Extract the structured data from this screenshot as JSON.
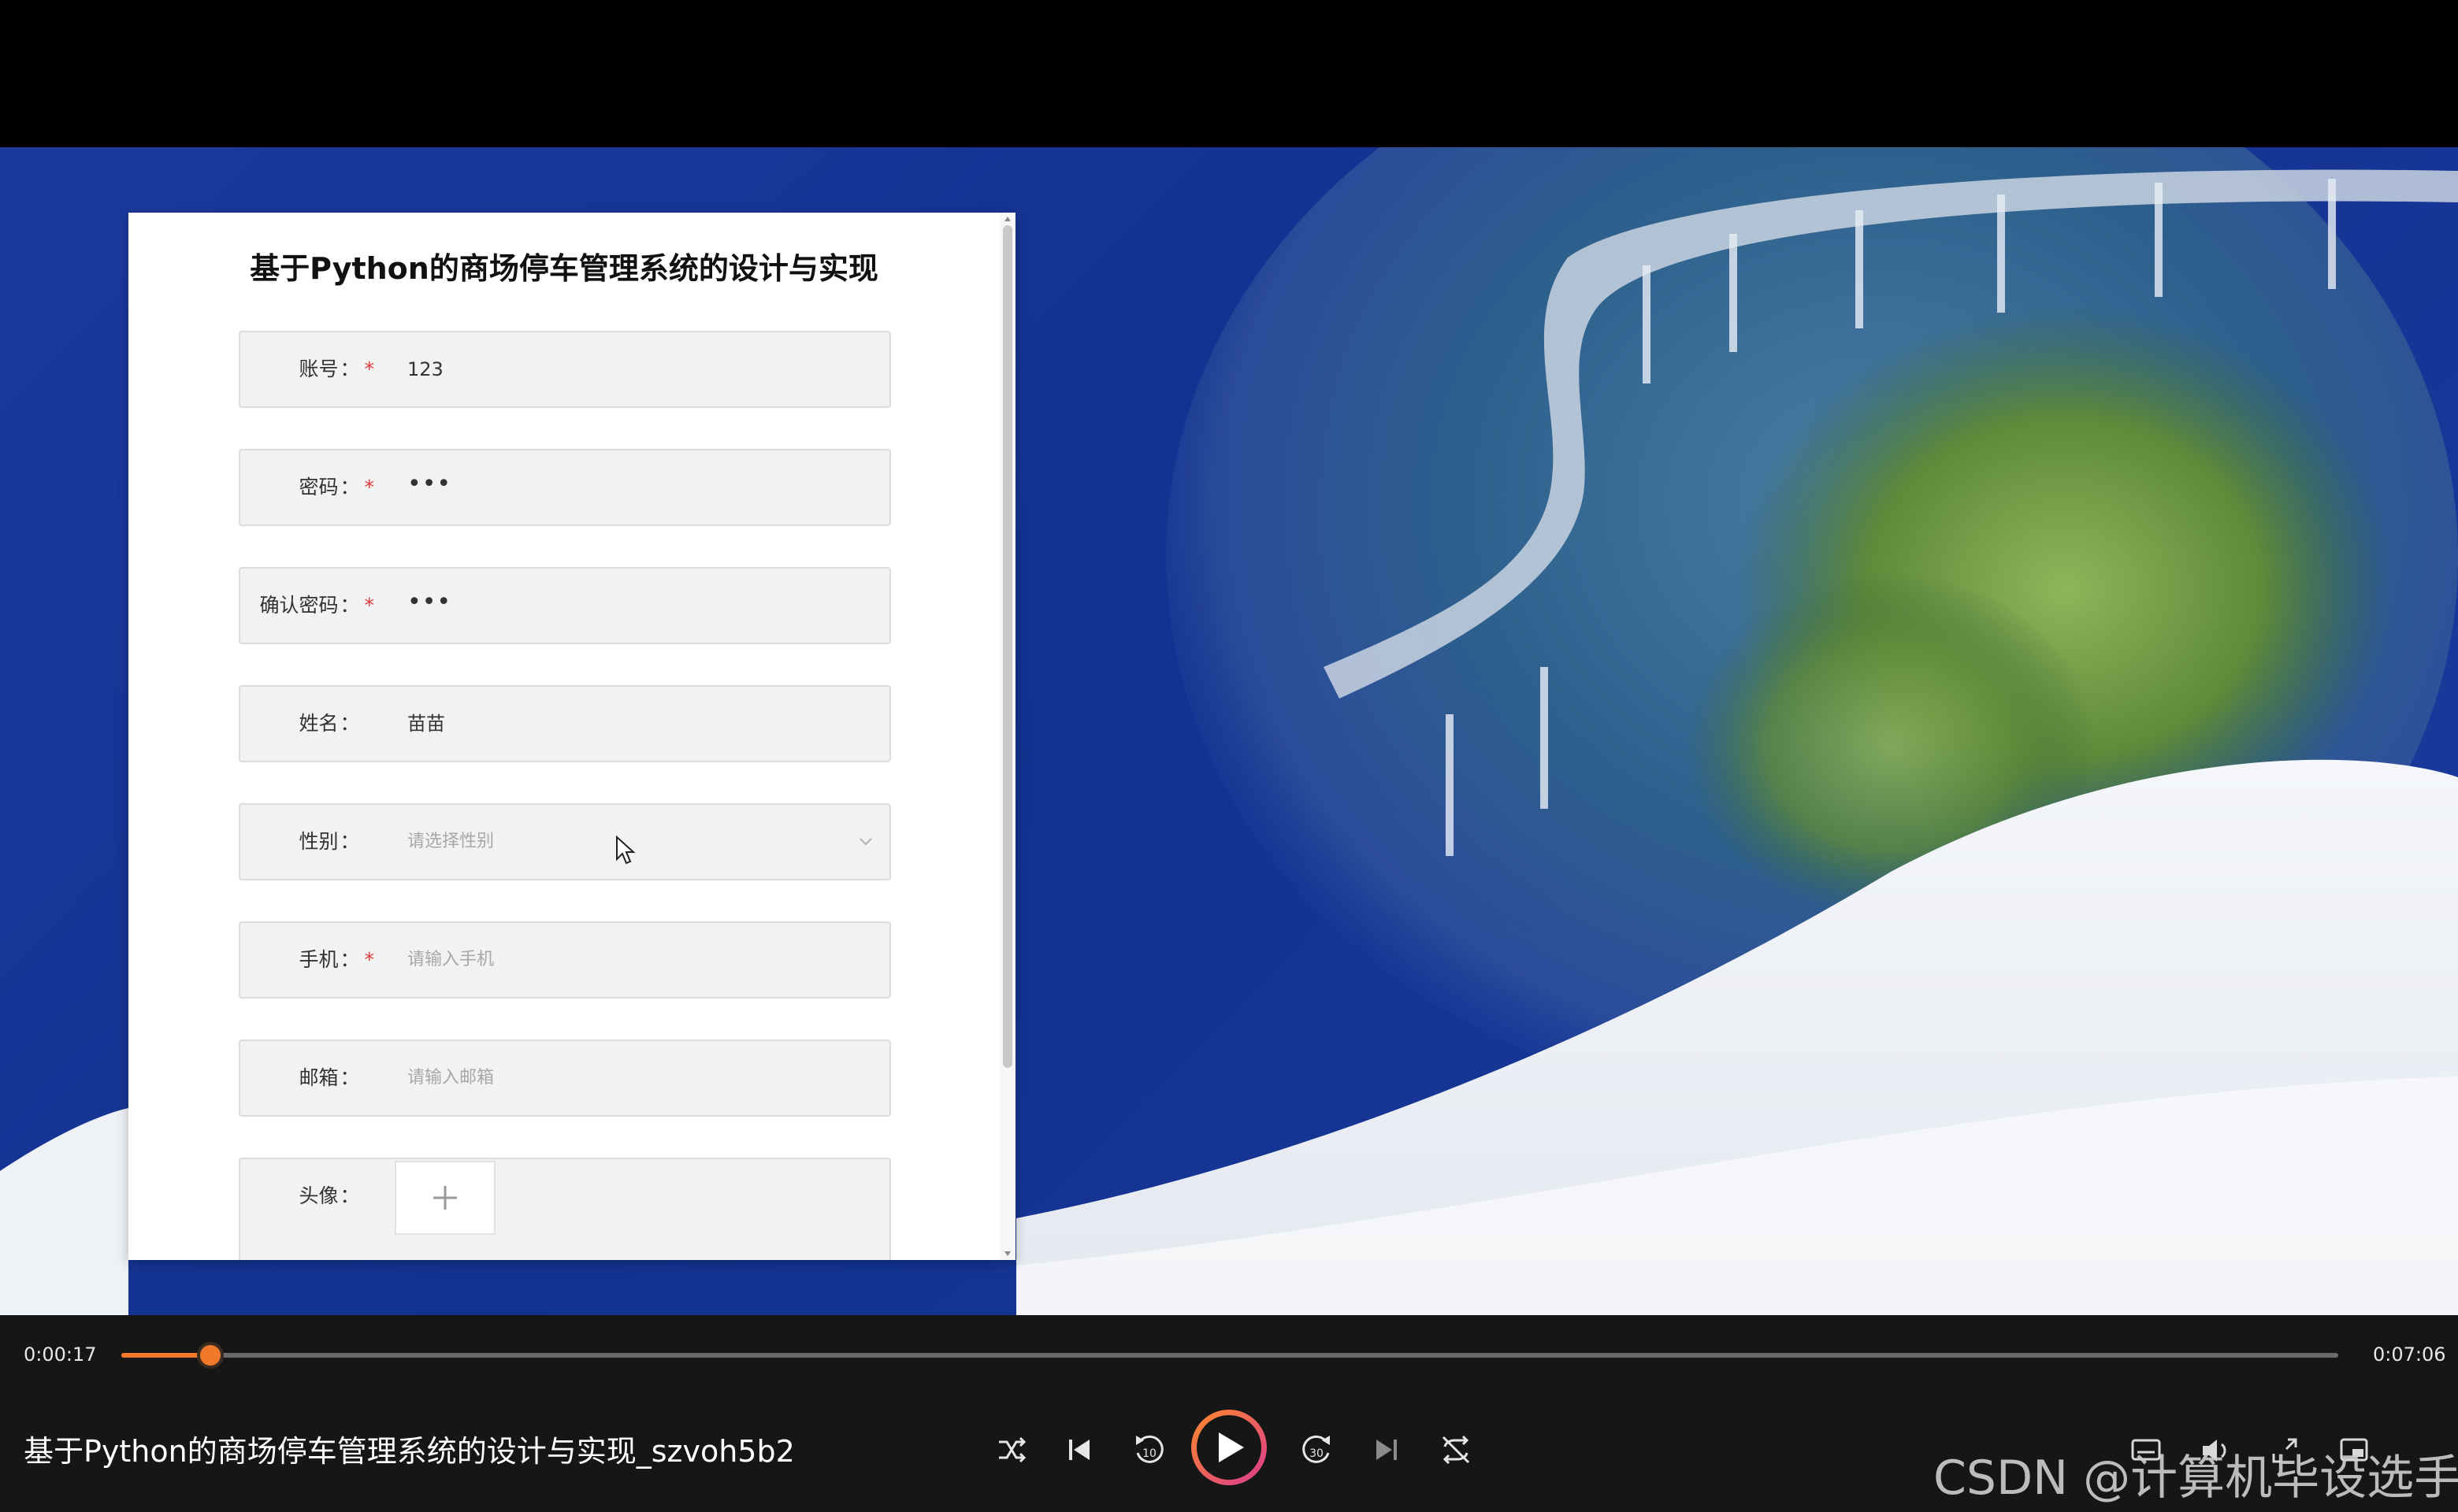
{
  "form": {
    "title": "基于Python的商场停车管理系统的设计与实现",
    "fields": [
      {
        "label": "账号",
        "required": true,
        "value": "123",
        "placeholder": ""
      },
      {
        "label": "密码",
        "required": true,
        "value": "•••",
        "placeholder": ""
      },
      {
        "label": "确认密码",
        "required": true,
        "value": "•••",
        "placeholder": ""
      },
      {
        "label": "姓名",
        "required": false,
        "value": "苗苗",
        "placeholder": ""
      },
      {
        "label": "性别",
        "required": false,
        "value": "",
        "placeholder": "请选择性别"
      },
      {
        "label": "手机",
        "required": true,
        "value": "",
        "placeholder": "请输入手机"
      },
      {
        "label": "邮箱",
        "required": false,
        "value": "",
        "placeholder": "请输入邮箱"
      },
      {
        "label": "头像",
        "required": false,
        "value": "",
        "placeholder": ""
      }
    ],
    "required_mark": "*",
    "colon": "："
  },
  "player": {
    "time_current": "0:00:17",
    "time_total": "0:07:06",
    "progress_fraction": 0.04,
    "title": "基于Python的商场停车管理系统的设计与实现_szvoh5b2",
    "watermark": "CSDN @计算机毕设选手",
    "rewind_seconds": "10",
    "forward_seconds": "30"
  },
  "colors": {
    "accent": "#f07a2a",
    "required": "#e23a3a",
    "background_blue": "#13318f"
  },
  "icons": [
    "shuffle-icon",
    "previous-icon",
    "rewind-10-icon",
    "play-icon",
    "forward-30-icon",
    "next-icon",
    "loop-icon",
    "subtitle-icon",
    "volume-icon",
    "fullscreen-icon",
    "pip-icon",
    "plus-icon",
    "chevron-down-icon"
  ]
}
